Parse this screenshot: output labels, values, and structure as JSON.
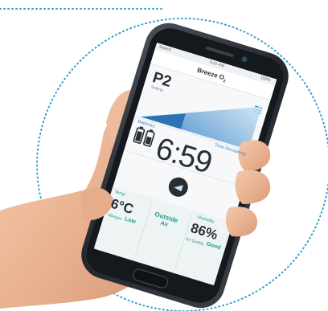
{
  "app": {
    "status_left": "Search",
    "status_time": "9:41 AM",
    "status_right": "100%",
    "title": "Breeze O",
    "title_sub": "2"
  },
  "mode": {
    "label": "P2",
    "sub": "Setting"
  },
  "battery": {
    "label": "Batteries",
    "count": 2
  },
  "time_remaining": {
    "label": "Time Remaining",
    "value": "6:59"
  },
  "stats": {
    "temp_label": "Temp",
    "temp_value": "6°C",
    "allergen_label": "Allergen",
    "allergen_value": "Low",
    "outside_label": "Outside",
    "outside_sub": "Air",
    "humidity_label": "Humidity",
    "humidity_value": "86%",
    "aq_label": "Air Quality",
    "aq_value": "Good"
  },
  "colors": {
    "frame_dots": "#2d9fd0",
    "accent": "#3b86c8",
    "teal": "#1e9d91",
    "phone_body": "#2b2f36",
    "screen_bg": "#f7f8fa"
  },
  "icons": [
    "battery-icon",
    "power-button-icon",
    "menu-icon",
    "home-button-icon"
  ]
}
